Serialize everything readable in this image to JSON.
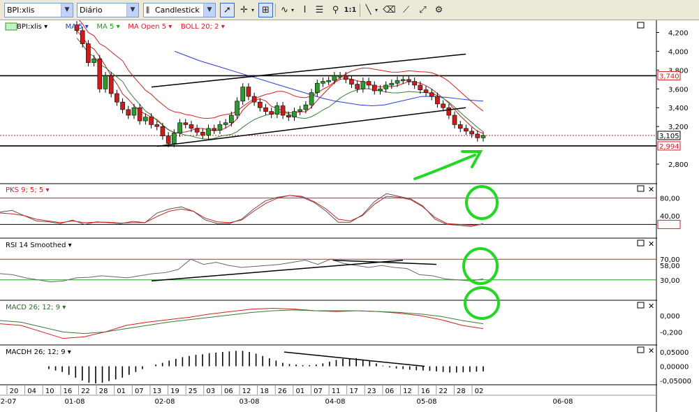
{
  "toolbar": {
    "symbol": "BPI:xlis",
    "period": "Diário",
    "chart_style": "Candlestick",
    "zoom_label": "1:1",
    "tools": [
      "pointer-icon",
      "crosshair-icon",
      "grid-icon",
      "indicator-icon",
      "text-icon",
      "magnifier-icon",
      "zoom-1to1-icon",
      "trendline-icon",
      "eraser-icon",
      "channel-icon",
      "expand-icon",
      "properties-icon"
    ]
  },
  "panels": {
    "price": {
      "legend": [
        "BPI:xlis",
        "MA 5",
        "MA 5",
        "MA Open 5",
        "BOLL 20; 2"
      ],
      "legend_colors": [
        "#000000",
        "#1b3fb5",
        "#17a317",
        "#d42020",
        "#d42020"
      ],
      "ticks": [
        "4,200",
        "4,000",
        "3,800",
        "3,600",
        "3,400",
        "3,200",
        "2,800"
      ],
      "badges": {
        "resistance": "3,740",
        "last": "3,105",
        "support": "2,994"
      }
    },
    "pks": {
      "label": "PKS 9; 5; 5",
      "ticks": [
        "80,00",
        "40,00",
        "20,00"
      ],
      "badge_low": "20,00"
    },
    "rsi": {
      "label": "RSI 14 Smoothed",
      "ticks": [
        "70,00",
        "58,00",
        "30,00"
      ]
    },
    "macd": {
      "label": "MACD 26; 12; 9",
      "ticks": [
        "0,000",
        "-0,200"
      ]
    },
    "macdh": {
      "label": "MACDH 26; 12; 9",
      "ticks": [
        "0,05000",
        "0,00000",
        "-0,05000"
      ]
    }
  },
  "colors": {
    "up": "#2c9b2c",
    "down": "#cc1d1d",
    "annotation_green": "#22d822",
    "red_line": "#d42020",
    "blue_line": "#2a3bd6",
    "green_line": "#3a7a3a"
  },
  "chart_data": {
    "type": "candlestick",
    "title": "BPI:xlis",
    "ylim": [
      2600,
      4300
    ],
    "x_day_ticks": [
      "20",
      "04",
      "10",
      "16",
      "22",
      "28",
      "01",
      "07",
      "13",
      "19",
      "25",
      "03",
      "06",
      "12",
      "18",
      "26",
      "01",
      "07",
      "11",
      "17",
      "23",
      "06",
      "12",
      "16",
      "22",
      "28",
      "02"
    ],
    "x_month_ticks": [
      "2-07",
      "01-08",
      "02-08",
      "03-08",
      "04-08",
      "05-08",
      "06-08"
    ],
    "close": [
      4220,
      4080,
      3880,
      3920,
      3600,
      3740,
      3550,
      3460,
      3380,
      3320,
      3400,
      3260,
      3300,
      3220,
      3200,
      3100,
      3020,
      3130,
      3240,
      3220,
      3180,
      3140,
      3110,
      3180,
      3160,
      3220,
      3240,
      3320,
      3470,
      3620,
      3520,
      3460,
      3400,
      3360,
      3330,
      3420,
      3320,
      3300,
      3360,
      3380,
      3430,
      3560,
      3660,
      3680,
      3690,
      3740,
      3740,
      3700,
      3650,
      3600,
      3680,
      3640,
      3580,
      3600,
      3640,
      3660,
      3690,
      3700,
      3680,
      3640,
      3590,
      3560,
      3520,
      3440,
      3400,
      3320,
      3220,
      3180,
      3150,
      3120,
      3080,
      3105
    ],
    "ma_blue": [
      4000,
      3950,
      3900,
      3860,
      3820,
      3780,
      3740,
      3700,
      3660,
      3620,
      3580,
      3540,
      3500,
      3470,
      3450,
      3430,
      3420,
      3430,
      3460,
      3490,
      3520,
      3520,
      3510,
      3495,
      3480,
      3470
    ],
    "pks": {
      "k": [
        48,
        52,
        40,
        28,
        26,
        22,
        30,
        20,
        26,
        24,
        22,
        27,
        24,
        46,
        55,
        60,
        50,
        30,
        22,
        22,
        32,
        55,
        74,
        82,
        86,
        82,
        70,
        50,
        25,
        25,
        42,
        72,
        90,
        84,
        78,
        62,
        32,
        20,
        18,
        15,
        22
      ],
      "d": [
        46,
        44,
        40,
        32,
        28,
        24,
        28,
        24,
        25,
        25,
        23,
        24,
        24,
        38,
        50,
        55,
        50,
        34,
        26,
        24,
        30,
        50,
        68,
        80,
        86,
        84,
        72,
        55,
        32,
        28,
        40,
        66,
        84,
        82,
        76,
        60,
        36,
        22,
        20,
        18,
        20
      ],
      "levels": [
        80,
        20
      ]
    },
    "rsi": {
      "values": [
        42,
        40,
        34,
        30,
        26,
        28,
        34,
        35,
        38,
        36,
        34,
        38,
        42,
        44,
        50,
        70,
        60,
        64,
        58,
        54,
        56,
        58,
        60,
        64,
        68,
        60,
        70,
        62,
        58,
        54,
        58,
        54,
        52,
        40,
        38,
        32,
        30,
        28,
        32
      ],
      "levels": [
        70,
        30
      ]
    },
    "macd": {
      "macd": [
        -0.1,
        -0.12,
        -0.2,
        -0.28,
        -0.26,
        -0.2,
        -0.12,
        -0.08,
        -0.05,
        -0.02,
        0.02,
        0.05,
        0.08,
        0.09,
        0.08,
        0.06,
        0.05,
        0.06,
        0.05,
        0.03,
        0.0,
        -0.05,
        -0.12,
        -0.16
      ],
      "signal": [
        -0.06,
        -0.08,
        -0.14,
        -0.2,
        -0.22,
        -0.2,
        -0.16,
        -0.12,
        -0.08,
        -0.05,
        -0.02,
        0.01,
        0.04,
        0.06,
        0.07,
        0.06,
        0.06,
        0.06,
        0.05,
        0.04,
        0.02,
        -0.01,
        -0.06,
        -0.1
      ]
    },
    "macdh": {
      "values": [
        -0.01,
        -0.015,
        -0.02,
        -0.03,
        -0.04,
        -0.05,
        -0.058,
        -0.06,
        -0.058,
        -0.052,
        -0.046,
        -0.04,
        -0.03,
        -0.02,
        -0.01,
        0.0,
        0.006,
        0.012,
        0.02,
        0.026,
        0.032,
        0.036,
        0.04,
        0.042,
        0.046,
        0.048,
        0.05,
        0.052,
        0.054,
        0.054,
        0.05,
        0.044,
        0.036,
        0.028,
        0.02,
        0.012,
        0.008,
        0.006,
        0.004,
        0.004,
        0.006,
        0.01,
        0.016,
        0.022,
        0.026,
        0.028,
        0.028,
        0.024,
        0.018,
        0.01,
        0.002,
        -0.004,
        -0.008,
        -0.01,
        -0.012,
        -0.014,
        -0.015,
        -0.016,
        -0.018,
        -0.02,
        -0.022,
        -0.022,
        -0.021,
        -0.02,
        -0.019,
        -0.018
      ]
    }
  }
}
